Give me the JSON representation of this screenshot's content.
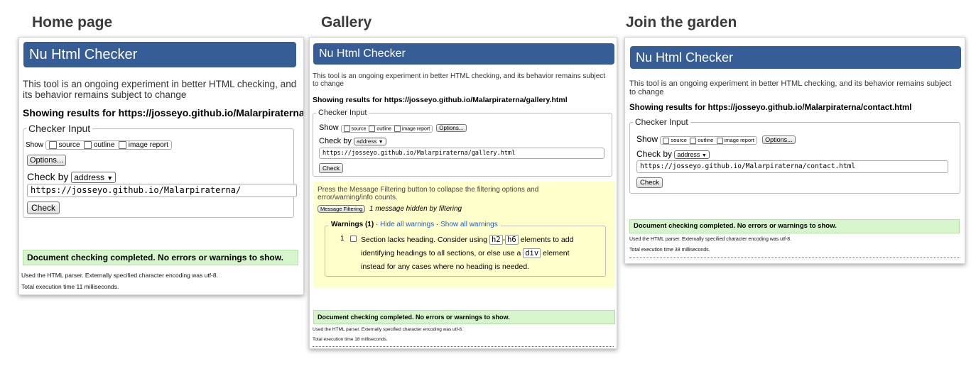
{
  "headings": {
    "home": "Home page",
    "gallery": "Gallery",
    "join": "Join the garden"
  },
  "colors": {
    "banner": "#365d95",
    "success_bg": "#d6f5cd",
    "message_bg": "#ffffcc"
  },
  "home": {
    "banner": "Nu Html Checker",
    "intro": "This tool is an ongoing experiment in better HTML checking, and its behavior remains subject to change",
    "results": "Showing results for https://josseyo.github.io/Malarpiraterna/",
    "legend": "Checker Input",
    "show_label": "Show",
    "opt_source": "source",
    "opt_outline": "outline",
    "opt_image": "image report",
    "options_button": "Options...",
    "check_by_label": "Check by",
    "check_by_value": "address",
    "url": "https://josseyo.github.io/Malarpiraterna/",
    "check_button": "Check",
    "success": "Document checking completed. No errors or warnings to show.",
    "parser": "Used the HTML parser. Externally specified character encoding was utf-8.",
    "time": "Total execution time 11 milliseconds."
  },
  "gallery": {
    "banner": "Nu Html Checker",
    "intro": "This tool is an ongoing experiment in better HTML checking, and its behavior remains subject to change",
    "results": "Showing results for https://josseyo.github.io/Malarpiraterna/gallery.html",
    "legend": "Checker Input",
    "show_label": "Show",
    "opt_source": "source",
    "opt_outline": "outline",
    "opt_image": "image report",
    "options_button": "Options...",
    "check_by_label": "Check by",
    "check_by_value": "address",
    "url": "https://josseyo.github.io/Malarpiraterna/gallery.html",
    "check_button": "Check",
    "filter_text": "Press the Message Filtering button to collapse the filtering options and error/warning/info counts.",
    "filter_button": "Message Filtering",
    "hidden_note": "1 message hidden by filtering",
    "warnings_legend": "Warnings (1)",
    "hide_link": "Hide all warnings",
    "show_link": "Show all warnings",
    "msg_number": "1",
    "msg_part1": "Section lacks heading. Consider using",
    "code_h2": "h2",
    "dash": "-",
    "code_h6": "h6",
    "msg_part2": "elements to add identifying headings to all sections, or else use a",
    "code_div": "div",
    "msg_part3": "element instead for any cases where no heading is needed.",
    "success": "Document checking completed. No errors or warnings to show.",
    "parser": "Used the HTML parser. Externally specified character encoding was utf-8.",
    "time": "Total execution time 18 milliseconds."
  },
  "join": {
    "banner": "Nu Html Checker",
    "intro": "This tool is an ongoing experiment in better HTML checking, and its behavior remains subject to change",
    "results": "Showing results for https://josseyo.github.io/Malarpiraterna/contact.html",
    "legend": "Checker Input",
    "show_label": "Show",
    "opt_source": "source",
    "opt_outline": "outline",
    "opt_image": "image report",
    "options_button": "Options...",
    "check_by_label": "Check by",
    "check_by_value": "address",
    "url": "https://josseyo.github.io/Malarpiraterna/contact.html",
    "check_button": "Check",
    "success": "Document checking completed. No errors or warnings to show.",
    "parser": "Used the HTML parser. Externally specified character encoding was utf-8.",
    "time": "Total execution time 38 milliseconds."
  }
}
